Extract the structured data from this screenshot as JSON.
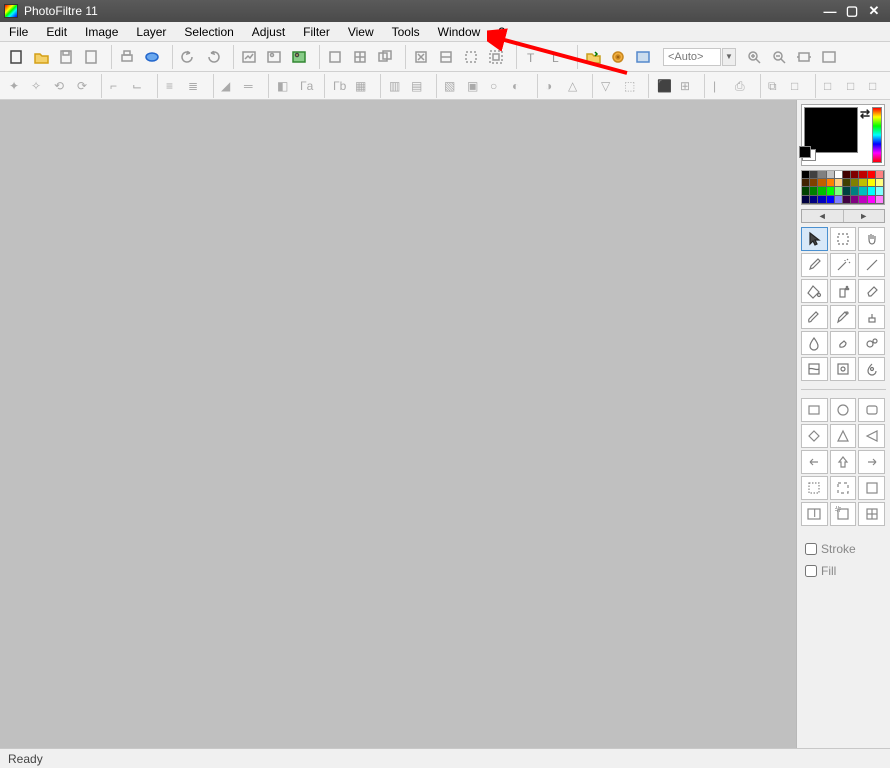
{
  "title": "PhotoFiltre 11",
  "menu": [
    "File",
    "Edit",
    "Image",
    "Layer",
    "Selection",
    "Adjust",
    "Filter",
    "View",
    "Tools",
    "Window",
    "?"
  ],
  "toolbar_auto": "<Auto>",
  "status": "Ready",
  "options": {
    "stroke": "Stroke",
    "fill": "Fill"
  },
  "palette": [
    "#000000",
    "#404040",
    "#808080",
    "#c0c0c0",
    "#ffffff",
    "#400000",
    "#800000",
    "#c00000",
    "#ff0000",
    "#ff8080",
    "#402000",
    "#804000",
    "#c06000",
    "#ff8000",
    "#ffcc80",
    "#404000",
    "#808000",
    "#c0c000",
    "#ffff00",
    "#ffff80",
    "#004000",
    "#008000",
    "#00c000",
    "#00ff00",
    "#80ff80",
    "#004040",
    "#008080",
    "#00c0c0",
    "#00ffff",
    "#80ffff",
    "#000040",
    "#000080",
    "#0000c0",
    "#0000ff",
    "#8080ff",
    "#400040",
    "#800080",
    "#c000c0",
    "#ff00ff",
    "#ff80ff"
  ],
  "tools": [
    {
      "id": "pointer",
      "sel": true
    },
    {
      "id": "selection",
      "sel": false
    },
    {
      "id": "hand",
      "sel": false
    },
    {
      "id": "pipette",
      "sel": false
    },
    {
      "id": "wand",
      "sel": false
    },
    {
      "id": "line",
      "sel": false
    },
    {
      "id": "fill",
      "sel": false
    },
    {
      "id": "spray",
      "sel": false
    },
    {
      "id": "eraser",
      "sel": false
    },
    {
      "id": "brush",
      "sel": false
    },
    {
      "id": "advbrush",
      "sel": false
    },
    {
      "id": "stamp",
      "sel": false
    },
    {
      "id": "blur",
      "sel": false
    },
    {
      "id": "smudge",
      "sel": false
    },
    {
      "id": "clone",
      "sel": false
    },
    {
      "id": "deform",
      "sel": false
    },
    {
      "id": "nozzle",
      "sel": false
    },
    {
      "id": "art",
      "sel": false
    }
  ],
  "shapes": [
    "rect",
    "circle",
    "roundrect",
    "diamond",
    "triangle",
    "rtriangle",
    "arrow-l",
    "arrow-u",
    "arrow-r",
    "sel-border",
    "sel-dash",
    "sel-solid",
    "text-box",
    "crop-box",
    "grid-box"
  ]
}
